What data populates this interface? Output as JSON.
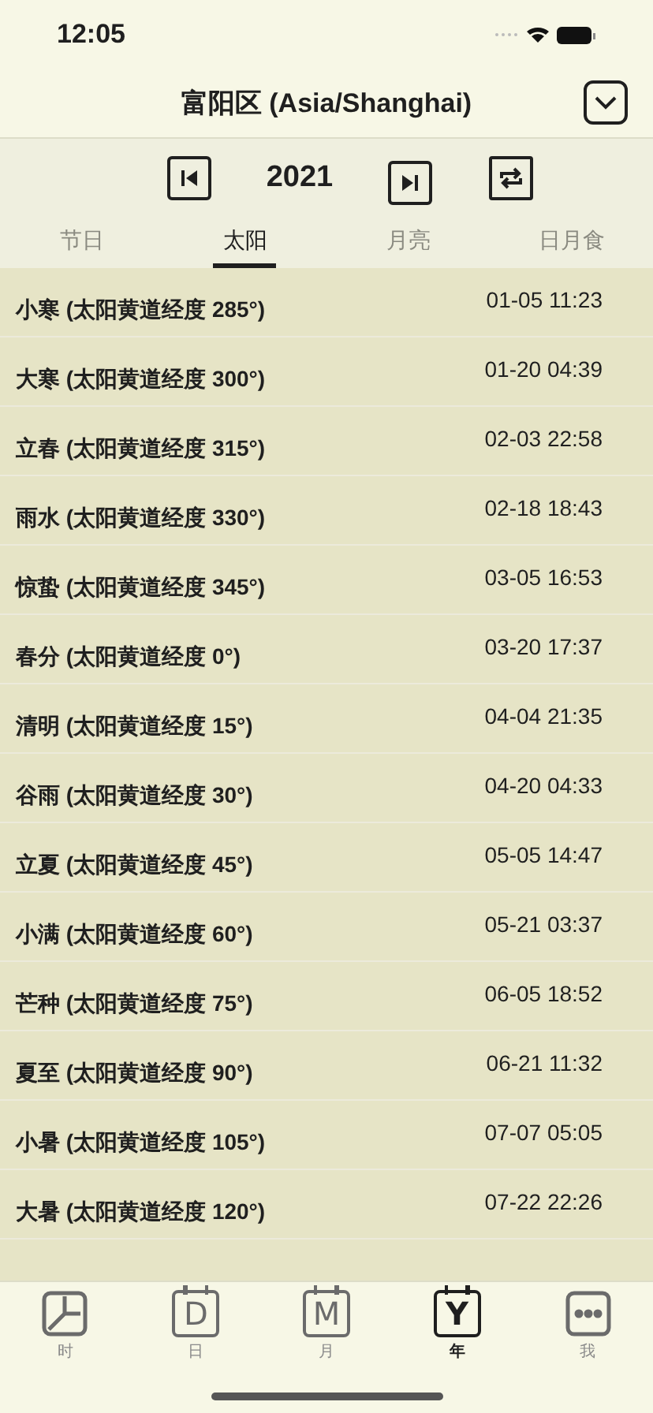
{
  "status_bar": {
    "time": "12:05"
  },
  "header": {
    "title": "富阳区 (Asia/Shanghai)"
  },
  "year_bar": {
    "year": "2021"
  },
  "tabs": [
    {
      "label": "节日",
      "selected": false
    },
    {
      "label": "太阳",
      "selected": true
    },
    {
      "label": "月亮",
      "selected": false
    },
    {
      "label": "日月食",
      "selected": false
    }
  ],
  "rows": [
    {
      "name": "小寒 (太阳黄道经度 285°)",
      "time": "01-05 11:23"
    },
    {
      "name": "大寒 (太阳黄道经度 300°)",
      "time": "01-20 04:39"
    },
    {
      "name": "立春 (太阳黄道经度 315°)",
      "time": "02-03 22:58"
    },
    {
      "name": "雨水 (太阳黄道经度 330°)",
      "time": "02-18 18:43"
    },
    {
      "name": "惊蛰 (太阳黄道经度 345°)",
      "time": "03-05 16:53"
    },
    {
      "name": "春分 (太阳黄道经度 0°)",
      "time": "03-20 17:37"
    },
    {
      "name": "清明 (太阳黄道经度 15°)",
      "time": "04-04 21:35"
    },
    {
      "name": "谷雨 (太阳黄道经度 30°)",
      "time": "04-20 04:33"
    },
    {
      "name": "立夏 (太阳黄道经度 45°)",
      "time": "05-05 14:47"
    },
    {
      "name": "小满 (太阳黄道经度 60°)",
      "time": "05-21 03:37"
    },
    {
      "name": "芒种 (太阳黄道经度 75°)",
      "time": "06-05 18:52"
    },
    {
      "name": "夏至 (太阳黄道经度 90°)",
      "time": "06-21 11:32"
    },
    {
      "name": "小暑 (太阳黄道经度 105°)",
      "time": "07-07 05:05"
    },
    {
      "name": "大暑 (太阳黄道经度 120°)",
      "time": "07-22 22:26"
    }
  ],
  "tab_bar": [
    {
      "label": "时",
      "kind": "clock",
      "selected": false
    },
    {
      "label": "日",
      "kind": "letter",
      "glyph": "D",
      "selected": false
    },
    {
      "label": "月",
      "kind": "letter",
      "glyph": "M",
      "selected": false
    },
    {
      "label": "年",
      "kind": "letter",
      "glyph": "Y",
      "selected": true
    },
    {
      "label": "我",
      "kind": "more",
      "selected": false
    }
  ]
}
